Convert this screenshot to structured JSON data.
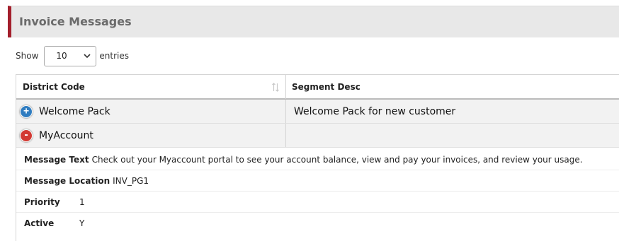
{
  "panel": {
    "title": "Invoice Messages",
    "accent_color": "#a31f2c"
  },
  "length": {
    "show_label": "Show",
    "selected": "10",
    "entries_label": "entries"
  },
  "table": {
    "headers": {
      "district_code": "District Code",
      "segment_desc": "Segment Desc"
    },
    "rows": [
      {
        "district_code": "Welcome Pack",
        "segment_desc": "Welcome Pack for new customer",
        "expanded": false
      },
      {
        "district_code": "MyAccount",
        "segment_desc": "",
        "expanded": true
      }
    ],
    "detail": {
      "message_text_label": "Message Text",
      "message_text": "Check out your Myaccount portal to see your account balance, view and pay your invoices, and review your usage.",
      "message_location_label": "Message Location",
      "message_location": "INV_PG1",
      "priority_label": "Priority",
      "priority": "1",
      "active_label": "Active",
      "active": "Y"
    }
  }
}
